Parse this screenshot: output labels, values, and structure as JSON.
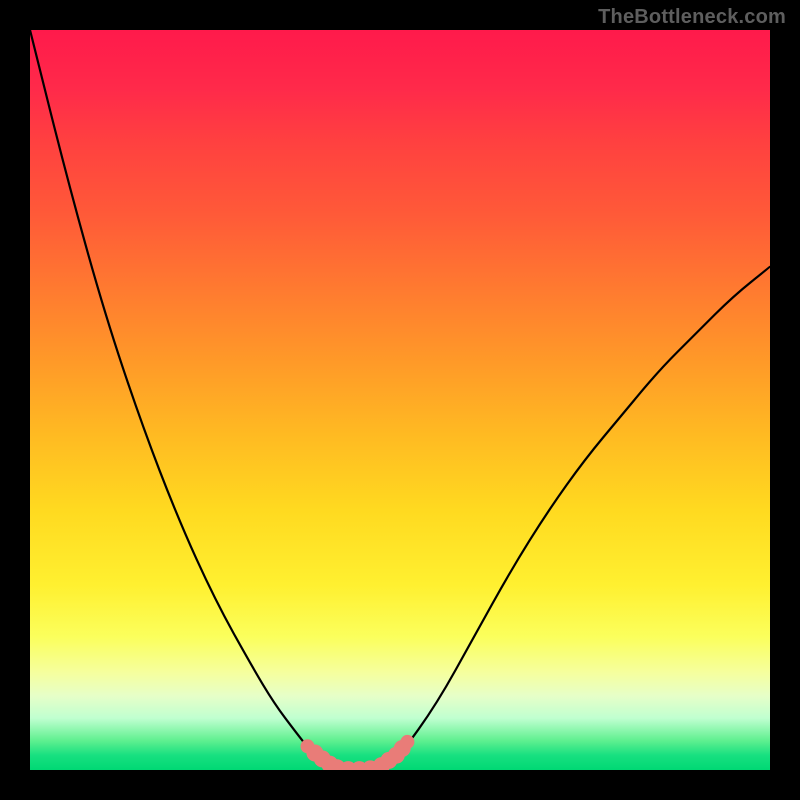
{
  "watermark": "TheBottleneck.com",
  "chart_data": {
    "type": "line",
    "title": "",
    "xlabel": "",
    "ylabel": "",
    "categories": [],
    "x": [
      0,
      5,
      10,
      15,
      20,
      25,
      30,
      33,
      36,
      38,
      40,
      42,
      44,
      46,
      48,
      50,
      55,
      60,
      65,
      70,
      75,
      80,
      85,
      90,
      95,
      100
    ],
    "series": [
      {
        "name": "bottleneck-curve",
        "values": [
          100,
          80,
          62,
          47,
          34,
          23,
          14,
          9,
          5,
          2.5,
          1,
          0.2,
          0,
          0,
          0.6,
          2,
          9,
          18,
          27,
          35,
          42,
          48,
          54,
          59,
          64,
          68
        ]
      }
    ],
    "marker_points": {
      "name": "highlight-dots",
      "x": [
        37.5,
        38.5,
        39.5,
        40.5,
        41.5,
        43,
        44.5,
        46,
        47.5,
        48.5,
        49.5,
        50.3,
        51
      ],
      "y": [
        3.2,
        2.3,
        1.5,
        0.8,
        0.3,
        0.05,
        0.05,
        0.15,
        0.6,
        1.3,
        2.0,
        2.9,
        3.8
      ]
    },
    "xlim": [
      0,
      100
    ],
    "ylim": [
      0,
      100
    ],
    "legend": false,
    "grid": false,
    "colors": {
      "curve": "#000000",
      "markers": "#e97c78",
      "frame": "#000000"
    }
  }
}
